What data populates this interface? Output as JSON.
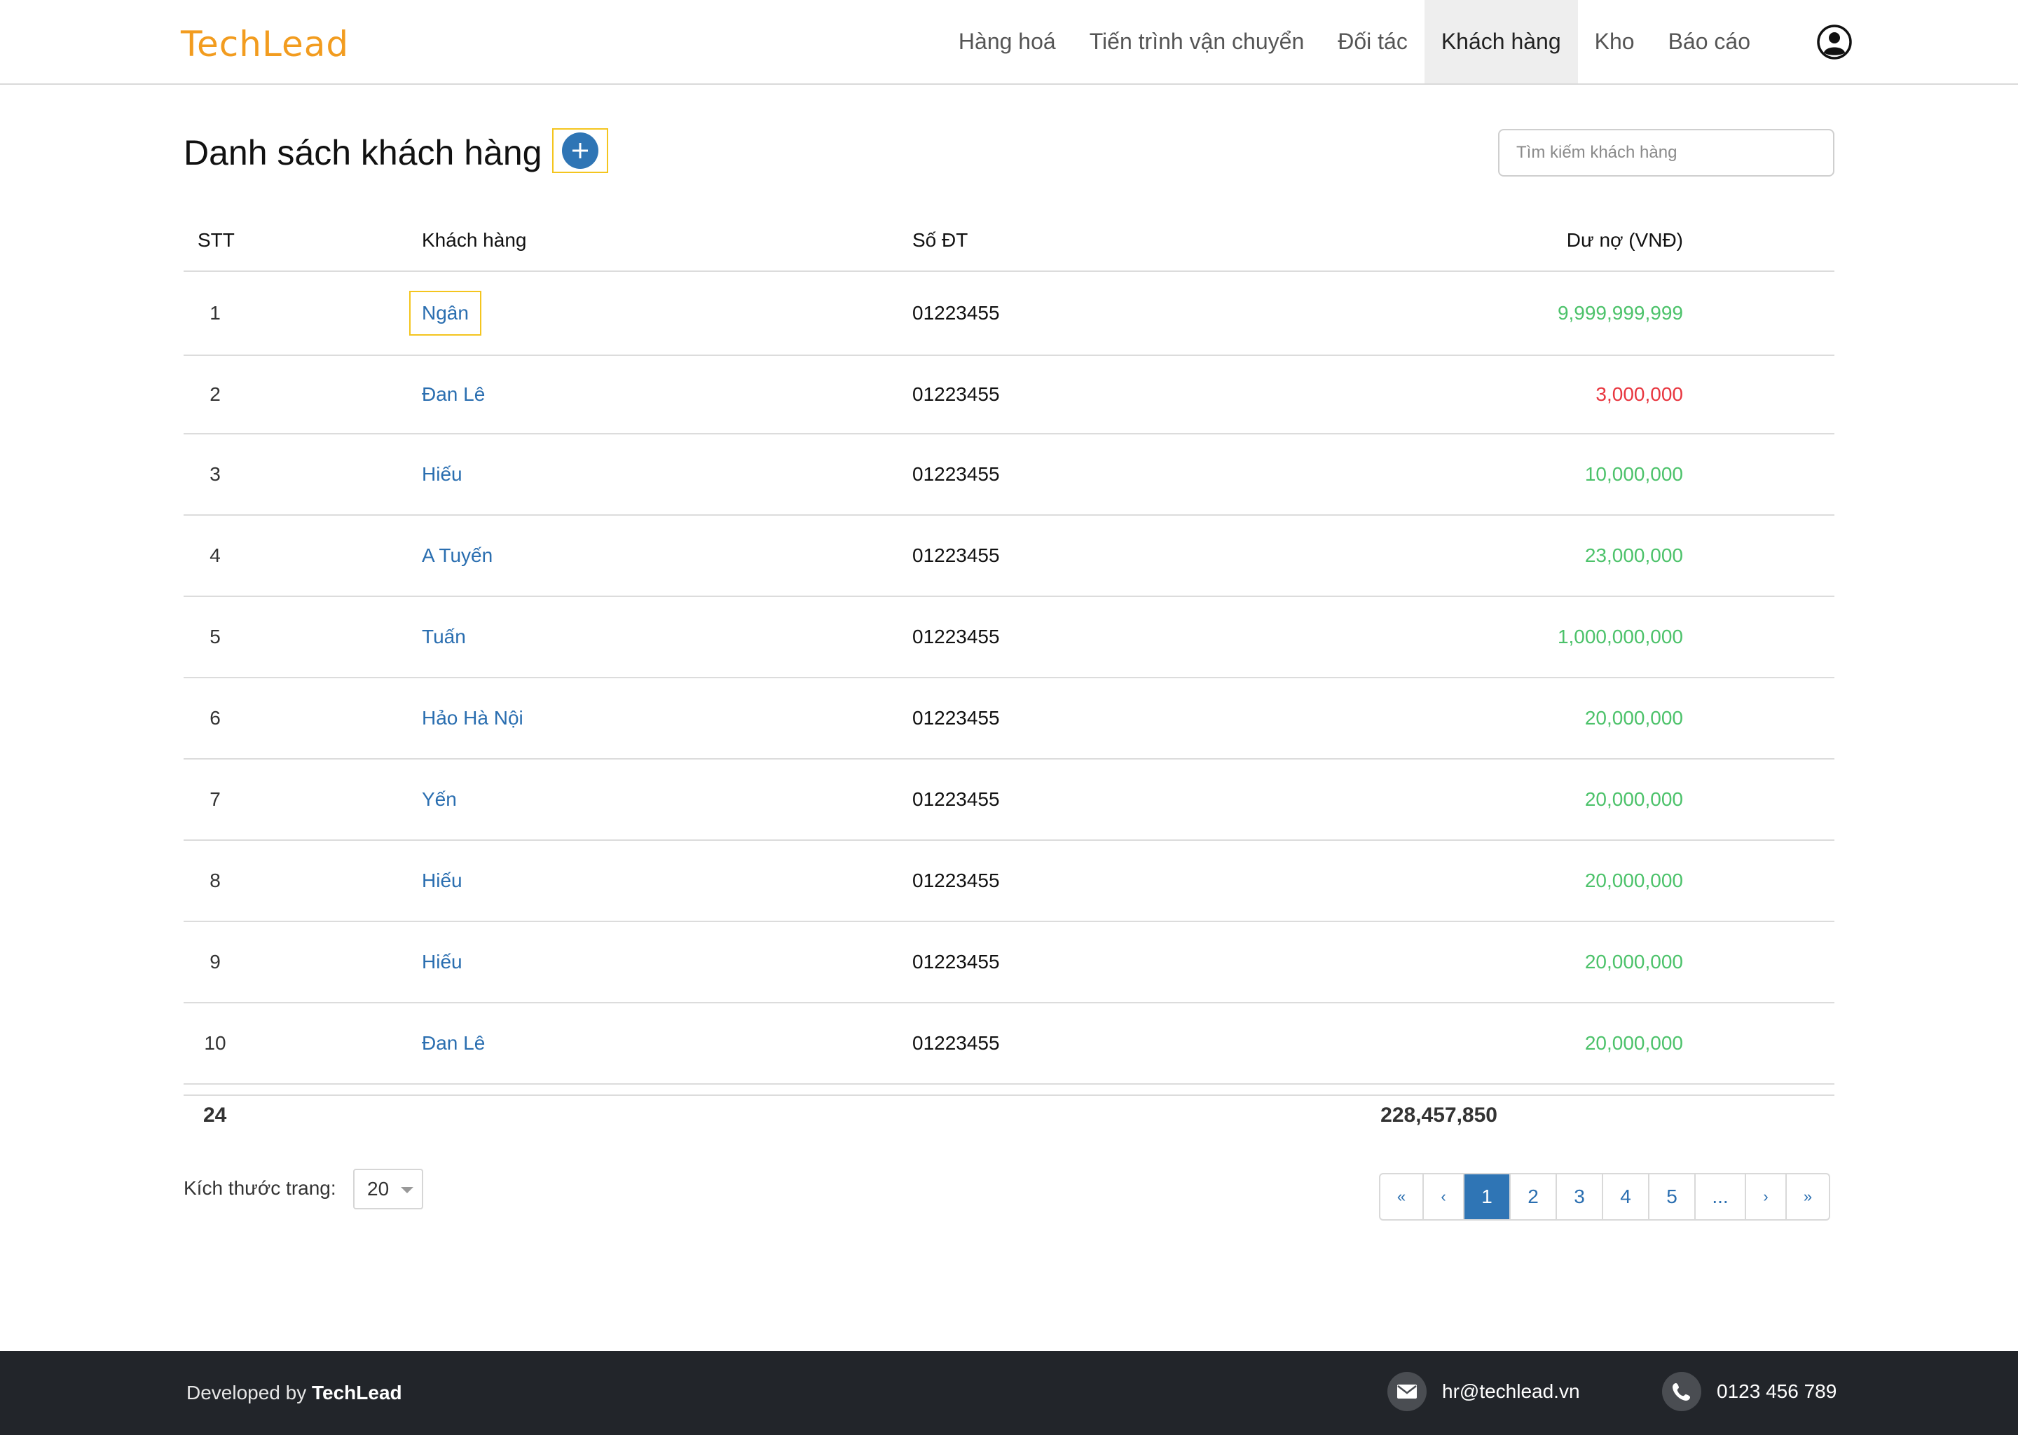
{
  "brand": {
    "logo": "TechLead",
    "color": "#f29c1f"
  },
  "nav": {
    "items": [
      {
        "label": "Hàng hoá"
      },
      {
        "label": "Tiến trình vận chuyển"
      },
      {
        "label": "Đối tác"
      },
      {
        "label": "Khách hàng",
        "active": true
      },
      {
        "label": "Kho"
      },
      {
        "label": "Báo cáo"
      }
    ],
    "user_icon": "user-circle-icon"
  },
  "page": {
    "title": "Danh sách khách hàng",
    "add_icon": "plus-icon",
    "search_placeholder": "Tìm kiếm khách hàng"
  },
  "table": {
    "headers": {
      "stt": "STT",
      "name": "Khách hàng",
      "phone": "Số ĐT",
      "debt": "Dư nợ (VNĐ)"
    },
    "rows": [
      {
        "stt": "1",
        "name": "Ngân",
        "phone": "01223455",
        "debt": "9,999,999,999",
        "status": "positive"
      },
      {
        "stt": "2",
        "name": "Đan Lê",
        "phone": "01223455",
        "debt": "3,000,000",
        "status": "negative"
      },
      {
        "stt": "3",
        "name": "Hiếu",
        "phone": "01223455",
        "debt": "10,000,000",
        "status": "positive"
      },
      {
        "stt": "4",
        "name": "A Tuyến",
        "phone": "01223455",
        "debt": "23,000,000",
        "status": "positive"
      },
      {
        "stt": "5",
        "name": "Tuấn",
        "phone": "01223455",
        "debt": "1,000,000,000",
        "status": "positive"
      },
      {
        "stt": "6",
        "name": "Hảo Hà Nội",
        "phone": "01223455",
        "debt": "20,000,000",
        "status": "positive"
      },
      {
        "stt": "7",
        "name": "Yến",
        "phone": "01223455",
        "debt": "20,000,000",
        "status": "positive"
      },
      {
        "stt": "8",
        "name": "Hiếu",
        "phone": "01223455",
        "debt": "20,000,000",
        "status": "positive"
      },
      {
        "stt": "9",
        "name": "Hiếu",
        "phone": "01223455",
        "debt": "20,000,000",
        "status": "positive"
      },
      {
        "stt": "10",
        "name": "Đan Lê",
        "phone": "01223455",
        "debt": "20,000,000",
        "status": "positive"
      }
    ],
    "total": {
      "count": "24",
      "debt": "228,457,850"
    }
  },
  "pager": {
    "page_size_label": "Kích thước trang:",
    "page_size": "20",
    "buttons": [
      "«",
      "‹",
      "1",
      "2",
      "3",
      "4",
      "5",
      "...",
      "›",
      "»"
    ],
    "active": "1"
  },
  "footer": {
    "developed_prefix": "Developed by",
    "developed_brand": "TechLead",
    "email": "hr@techlead.vn",
    "phone": "0123 456 789",
    "email_icon": "envelope-icon",
    "phone_icon": "phone-icon"
  },
  "colors": {
    "positive": "#4cc26a",
    "negative": "#e8363f",
    "link": "#2a6eb0",
    "accent": "#2f75b5",
    "highlight": "#f4c51e"
  }
}
